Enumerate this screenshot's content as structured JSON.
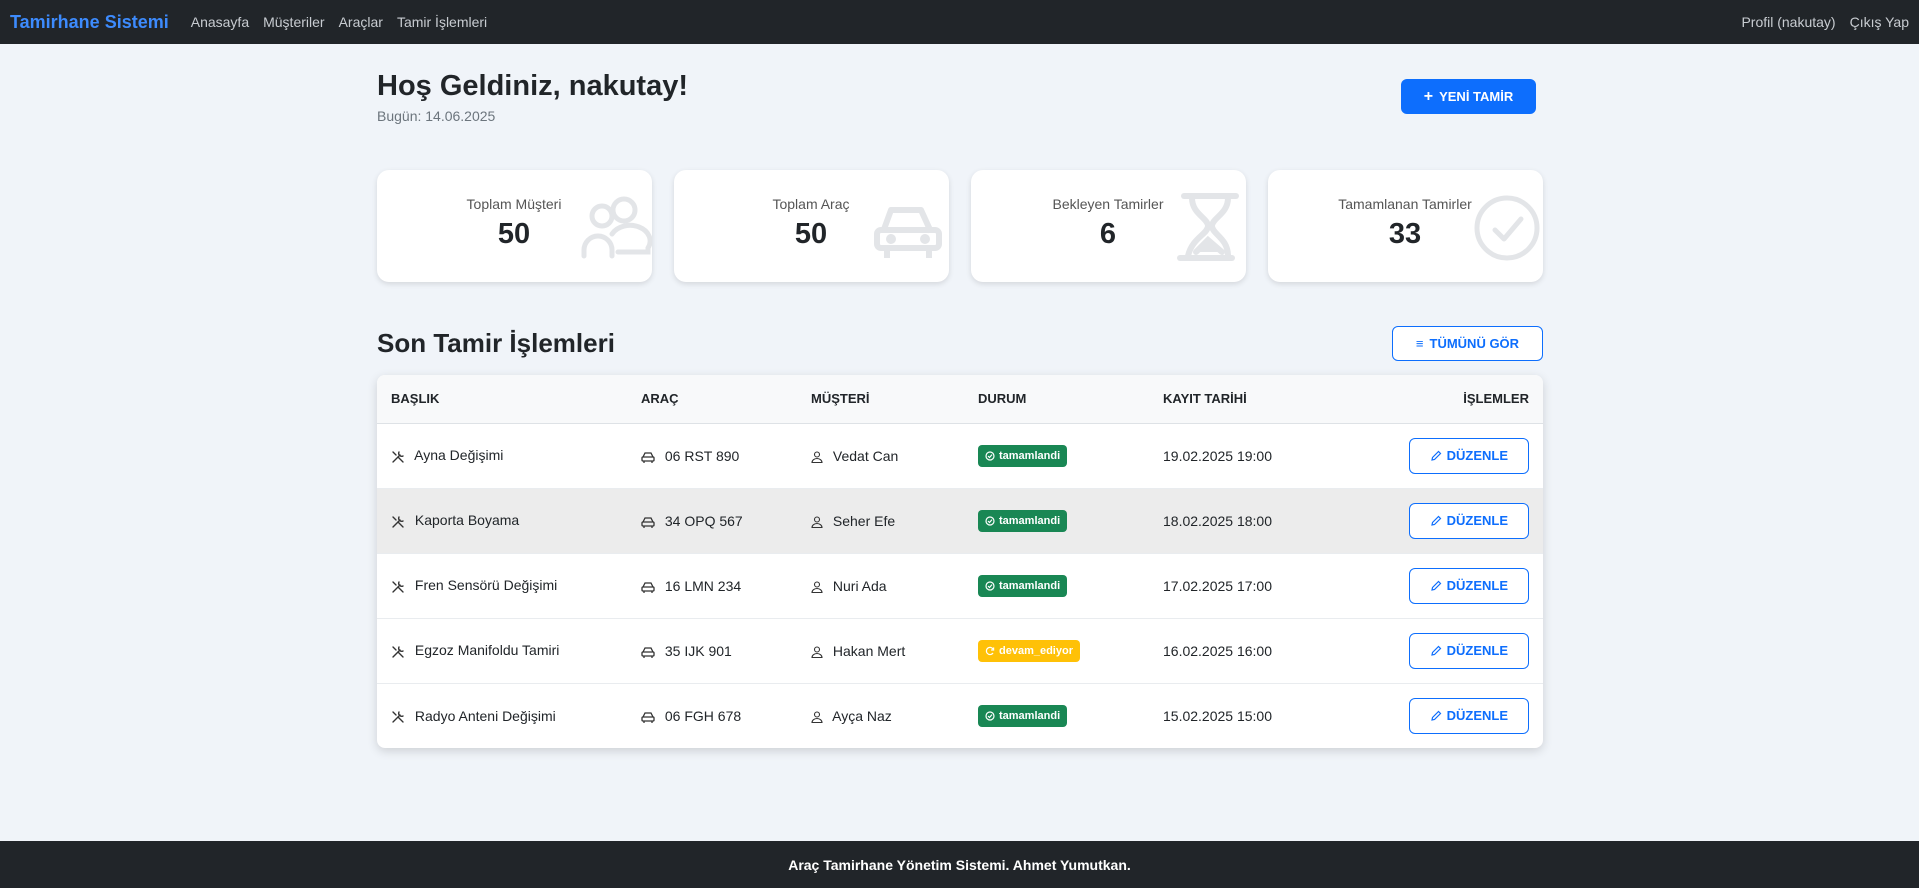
{
  "navbar": {
    "brand": "Tamirhane Sistemi",
    "links": [
      "Anasayfa",
      "Müşteriler",
      "Araçlar",
      "Tamir İşlemleri"
    ],
    "profile": "Profil (nakutay)",
    "logout": "Çıkış Yap"
  },
  "header": {
    "welcome": "Hoş Geldiniz, nakutay!",
    "today_label": "Bugün: 14.06.2025",
    "new_button": "YENİ TAMİR"
  },
  "stats": [
    {
      "label": "Toplam Müşteri",
      "value": "50",
      "icon": "users-icon"
    },
    {
      "label": "Toplam Araç",
      "value": "50",
      "icon": "car-icon"
    },
    {
      "label": "Bekleyen Tamirler",
      "value": "6",
      "icon": "hourglass-icon"
    },
    {
      "label": "Tamamlanan Tamirler",
      "value": "33",
      "icon": "check-circle-icon"
    }
  ],
  "recent": {
    "title": "Son Tamir İşlemleri",
    "view_all": "TÜMÜNÜ GÖR",
    "columns": [
      "BAŞLIK",
      "ARAÇ",
      "MÜŞTERİ",
      "DURUM",
      "KAYIT TARİHİ",
      "İŞLEMLER"
    ],
    "edit_label": "DÜZENLE",
    "rows": [
      {
        "title": "Ayna Değişimi",
        "plate": "06 RST 890",
        "customer": "Vedat Can",
        "status": "tamamlandi",
        "date": "19.02.2025 19:00"
      },
      {
        "title": "Kaporta Boyama",
        "plate": "34 OPQ 567",
        "customer": "Seher Efe",
        "status": "tamamlandi",
        "date": "18.02.2025 18:00"
      },
      {
        "title": "Fren Sensörü Değişimi",
        "plate": "16 LMN 234",
        "customer": "Nuri Ada",
        "status": "tamamlandi",
        "date": "17.02.2025 17:00"
      },
      {
        "title": "Egzoz Manifoldu Tamiri",
        "plate": "35 IJK 901",
        "customer": "Hakan Mert",
        "status": "devam_ediyor",
        "date": "16.02.2025 16:00"
      },
      {
        "title": "Radyo Anteni Değişimi",
        "plate": "06 FGH 678",
        "customer": "Ayça Naz",
        "status": "tamamlandi",
        "date": "15.02.2025 15:00"
      }
    ]
  },
  "footer": {
    "text": "Araç Tamirhane Yönetim Sistemi. Ahmet Yumutkan."
  },
  "colors": {
    "primary": "#0d6efd",
    "success": "#198754",
    "warning": "#ffc107",
    "dark": "#212529",
    "background": "#f0f4f9"
  }
}
